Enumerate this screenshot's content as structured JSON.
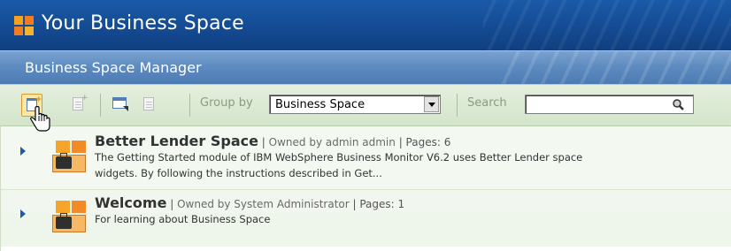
{
  "header": {
    "app_title": "Your Business Space",
    "manager_title": "Business Space Manager"
  },
  "toolbar": {
    "group_by_label": "Group by",
    "group_by_value": "Business Space",
    "search_label": "Search",
    "search_value": ""
  },
  "spaces": [
    {
      "name": "Better Lender Space",
      "owner_text": "Owned by admin admin",
      "pages_text": "Pages: 6",
      "desc_line1": "The Getting Started module of IBM WebSphere Business Monitor V6.2 uses Better Lender space",
      "desc_line2": "widgets. By following the instructions described in Get..."
    },
    {
      "name": "Welcome",
      "owner_text": "Owned by System Administrator",
      "pages_text": "Pages: 1",
      "desc_line1": "For learning about Business Space"
    }
  ],
  "colors": {
    "title_bar": "#1a5aa8",
    "manager_bar": "#5f8cc0",
    "toolbar": "#dce9d4",
    "row_bg": "#f1f6ef",
    "expander": "#1d5ba8"
  }
}
